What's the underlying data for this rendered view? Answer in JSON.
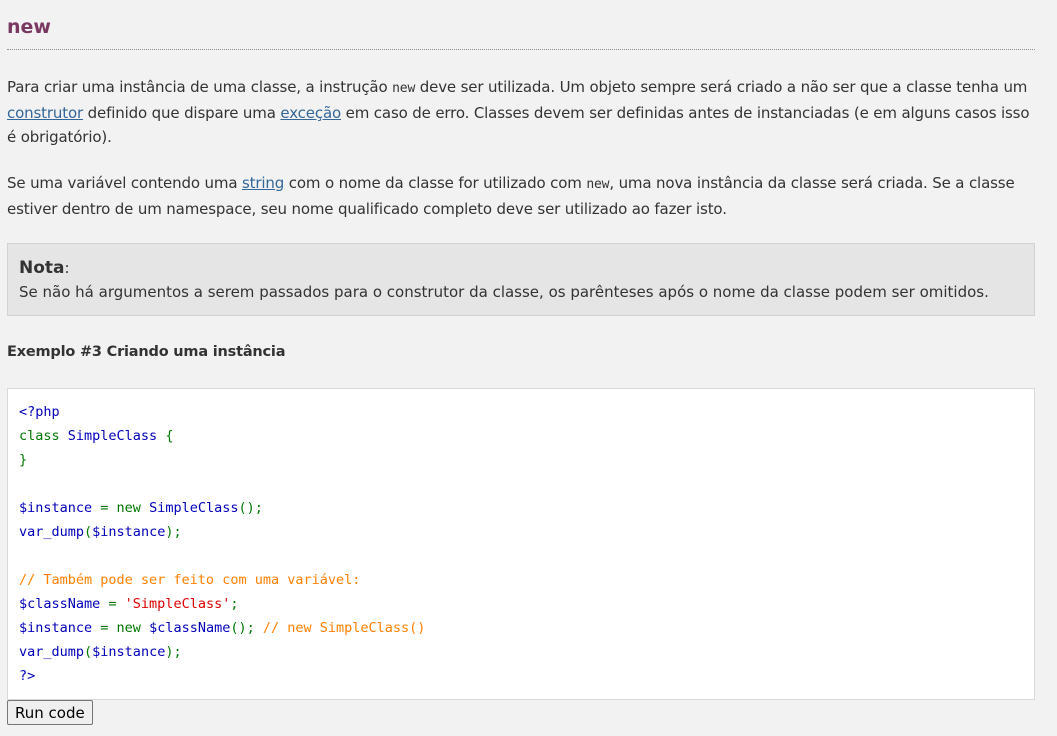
{
  "section": {
    "title": "new"
  },
  "paragraph1": {
    "t1": "Para criar uma instância de uma classe, a instrução ",
    "code1": "new",
    "t2": " deve ser utilizada. Um objeto sempre será criado a não ser que a classe tenha um ",
    "link1": "construtor",
    "t3": " definido que dispare uma ",
    "link2": "exceção",
    "t4": " em caso de erro. Classes devem ser definidas antes de instanciadas (e em alguns casos isso é obrigatório)."
  },
  "paragraph2": {
    "t1": "Se uma variável contendo uma ",
    "link1": "string",
    "t2": " com o nome da classe for utilizado com ",
    "code1": "new",
    "t3": ", uma nova instância da classe será criada. Se a classe estiver dentro de um namespace, seu nome qualificado completo deve ser utilizado ao fazer isto."
  },
  "note": {
    "title": "Nota",
    "colon": ":",
    "text": "Se não há argumentos a serem passados para o construtor da classe, os parênteses após o nome da classe podem ser omitidos."
  },
  "example": {
    "title": "Exemplo #3 Criando uma instância",
    "code": [
      [
        {
          "t": "<?php",
          "c": "blue"
        }
      ],
      [
        {
          "t": "class ",
          "c": "green"
        },
        {
          "t": "SimpleClass ",
          "c": "blue"
        },
        {
          "t": "{",
          "c": "green"
        }
      ],
      [
        {
          "t": "}",
          "c": "green"
        }
      ],
      [
        {
          "t": "",
          "c": "blue"
        }
      ],
      [
        {
          "t": "$instance ",
          "c": "blue"
        },
        {
          "t": "= new ",
          "c": "green"
        },
        {
          "t": "SimpleClass",
          "c": "blue"
        },
        {
          "t": "();",
          "c": "green"
        }
      ],
      [
        {
          "t": "var_dump",
          "c": "blue"
        },
        {
          "t": "(",
          "c": "green"
        },
        {
          "t": "$instance",
          "c": "blue"
        },
        {
          "t": ");",
          "c": "green"
        }
      ],
      [
        {
          "t": "",
          "c": "blue"
        }
      ],
      [
        {
          "t": "// Também pode ser feito com uma variável:",
          "c": "comment"
        }
      ],
      [
        {
          "t": "$className ",
          "c": "blue"
        },
        {
          "t": "= ",
          "c": "green"
        },
        {
          "t": "'SimpleClass'",
          "c": "string"
        },
        {
          "t": ";",
          "c": "green"
        }
      ],
      [
        {
          "t": "$instance ",
          "c": "blue"
        },
        {
          "t": "= new ",
          "c": "green"
        },
        {
          "t": "$className",
          "c": "blue"
        },
        {
          "t": "(); ",
          "c": "green"
        },
        {
          "t": "// new SimpleClass()",
          "c": "comment"
        }
      ],
      [
        {
          "t": "var_dump",
          "c": "blue"
        },
        {
          "t": "(",
          "c": "green"
        },
        {
          "t": "$instance",
          "c": "blue"
        },
        {
          "t": ");",
          "c": "green"
        }
      ],
      [
        {
          "t": "?>",
          "c": "blue"
        }
      ]
    ]
  },
  "run_button": {
    "label": "Run code"
  },
  "colors": {
    "title": "#793862",
    "link": "#336699",
    "code_blue": "#0000bb",
    "code_green": "#007700",
    "code_comment": "#ff8000",
    "code_string": "#dd0000"
  }
}
